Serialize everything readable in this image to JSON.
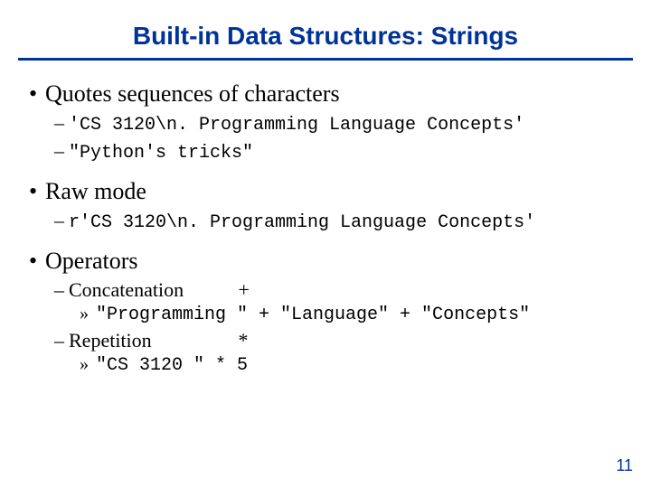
{
  "title": "Built-in Data Structures: Strings",
  "bullets": {
    "quotes": {
      "label": "Quotes sequences of characters",
      "items": [
        "'CS 3120\\n. Programming Language Concepts'",
        "\"Python's tricks\""
      ]
    },
    "raw": {
      "label": "Raw mode",
      "items": [
        "r'CS 3120\\n. Programming Language Concepts'"
      ]
    },
    "operators": {
      "label": "Operators",
      "concat": {
        "label": "Concatenation",
        "symbol": "+",
        "example": "\"Programming \" + \"Language\" + \"Concepts\""
      },
      "repeat": {
        "label": "Repetition",
        "symbol": "*",
        "example": "\"CS 3120 \" * 5"
      }
    }
  },
  "page_number": "11"
}
